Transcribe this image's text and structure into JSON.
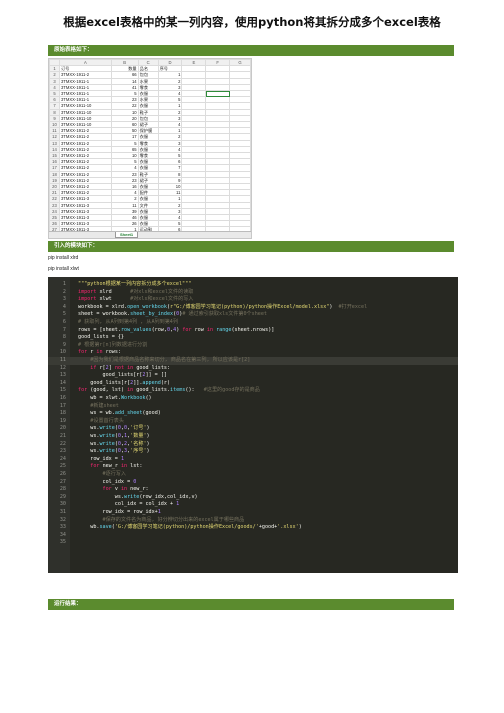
{
  "title": "根据excel表格中的某一列内容，使用python将其拆分成多个excel表格",
  "sections": {
    "original": "原始表格如下：",
    "imports": "引入的模块如下：",
    "result": "运行结果："
  },
  "pip_lines": [
    "pip install xlrd",
    "pip install xlwt"
  ],
  "excel": {
    "columns": [
      "",
      "A",
      "B",
      "C",
      "D",
      "E",
      "F",
      "G"
    ],
    "header_row": [
      "订号",
      "数量",
      "品名",
      "序号"
    ],
    "rows": [
      [
        "3TMXX-1911-2",
        "66",
        "包包",
        "1"
      ],
      [
        "3TMXX-1911-1",
        "14",
        "水果",
        "2"
      ],
      [
        "3TMXX-1911-1",
        "41",
        "零食",
        "3"
      ],
      [
        "3TMXX-1911-1",
        "5",
        "衣服",
        "4"
      ],
      [
        "3TMXX-1911-1",
        "23",
        "水果",
        "5"
      ],
      [
        "3TMXX-1911-10",
        "22",
        "衣服",
        "1"
      ],
      [
        "3TMXX-1911-10",
        "10",
        "鞋子",
        "2"
      ],
      [
        "3TMXX-1911-10",
        "20",
        "包包",
        "3"
      ],
      [
        "3TMXX-1911-10",
        "60",
        "裙子",
        "4"
      ],
      [
        "3TMXX-1911-2",
        "50",
        "保护膜",
        "1"
      ],
      [
        "3TMXX-1911-2",
        "17",
        "衣服",
        "2"
      ],
      [
        "3TMXX-1911-2",
        "5",
        "零食",
        "3"
      ],
      [
        "3TMXX-1911-2",
        "65",
        "衣服",
        "4"
      ],
      [
        "3TMXX-1911-2",
        "10",
        "零食",
        "5"
      ],
      [
        "3TMXX-1911-2",
        "5",
        "衣服",
        "6"
      ],
      [
        "3TMXX-1911-2",
        "4",
        "衣服",
        "7"
      ],
      [
        "3TMXX-1911-2",
        "23",
        "鞋子",
        "8"
      ],
      [
        "3TMXX-1911-2",
        "23",
        "裙子",
        "9"
      ],
      [
        "3TMXX-1911-2",
        "16",
        "衣服",
        "10"
      ],
      [
        "3TMXX-1911-2",
        "4",
        "配件",
        "11"
      ],
      [
        "3TMXX-1911-3",
        "2",
        "衣服",
        "1"
      ],
      [
        "3TMXX-1911-3",
        "11",
        "文件",
        "2"
      ],
      [
        "3TMXX-1911-3",
        "39",
        "衣服",
        "3"
      ],
      [
        "3TMXX-1911-3",
        "46",
        "衣服",
        "4"
      ],
      [
        "3TMXX-1911-3",
        "26",
        "衣服",
        "5"
      ],
      [
        "3TMXX-1911-3",
        "1",
        "运动鞋",
        "6"
      ]
    ],
    "sheet_tab": "Sheet1"
  },
  "code": {
    "highlight_line": 11,
    "lines": [
      [
        [
          "s",
          "\"\"\"python根据某一列内容拆分成多个excel\"\"\""
        ]
      ],
      [
        [
          "k",
          "import "
        ],
        [
          "",
          "xlrd      "
        ],
        [
          "c",
          "#对xls和excel文件的读取"
        ]
      ],
      [
        [
          "k",
          "import "
        ],
        [
          "",
          "xlwt      "
        ],
        [
          "c",
          "#对xls和excel文件的写入"
        ]
      ],
      [
        [
          "",
          "workbook = xlrd."
        ],
        [
          "f",
          "open_workbook"
        ],
        [
          "",
          "("
        ],
        [
          "s",
          "r\"G:/博客园学习笔记(python)/python操作Excel/model.xlsx\""
        ],
        [
          "",
          ")  "
        ],
        [
          "c",
          "#打开excel"
        ]
      ],
      [
        [
          "",
          "sheet = workbook."
        ],
        [
          "f",
          "sheet_by_index"
        ],
        [
          "",
          "("
        ],
        [
          "n",
          "0"
        ],
        [
          "",
          ")"
        ],
        [
          "c",
          "# 通过索引获取xls文件第0个sheet"
        ]
      ],
      [
        [
          "c",
          "# 获取列, 从A列到第4列 , 从A列到第4列"
        ]
      ],
      [
        [
          "",
          "rows = [sheet."
        ],
        [
          "f",
          "row_values"
        ],
        [
          "",
          "(row,"
        ],
        [
          "n",
          "0"
        ],
        [
          "",
          ","
        ],
        [
          "n",
          "4"
        ],
        [
          "",
          ") "
        ],
        [
          "k",
          "for "
        ],
        [
          "",
          "row "
        ],
        [
          "k",
          "in "
        ],
        [
          "f",
          "range"
        ],
        [
          "",
          "(sheet.nrows)]"
        ]
      ],
      [
        [
          "",
          "good_lists = {}"
        ]
      ],
      [
        [
          "c",
          "# 根据第r[n]列数据进行分割"
        ]
      ],
      [
        [
          "k",
          "for "
        ],
        [
          "",
          "r "
        ],
        [
          "k",
          "in "
        ],
        [
          "",
          "rows:"
        ]
      ],
      [
        [
          "",
          "    "
        ],
        [
          "c",
          "#因为我们是根据商品名称来切分, 商品名在第三列, 所以应该是r[2]"
        ]
      ],
      [
        [
          "",
          "    "
        ],
        [
          "k",
          "if "
        ],
        [
          "",
          "r["
        ],
        [
          "n",
          "2"
        ],
        [
          "",
          "] "
        ],
        [
          "k",
          "not in "
        ],
        [
          "",
          "good_lists:"
        ]
      ],
      [
        [
          "",
          "        good_lists[r["
        ],
        [
          "n",
          "2"
        ],
        [
          "",
          "]] = []"
        ]
      ],
      [
        [
          "",
          "    good_lists[r["
        ],
        [
          "n",
          "2"
        ],
        [
          "",
          "]]."
        ],
        [
          "f",
          "append"
        ],
        [
          "",
          "(r)"
        ]
      ],
      [
        [
          "k",
          "for "
        ],
        [
          "",
          "(good, lst) "
        ],
        [
          "k",
          "in "
        ],
        [
          "",
          "good_lists."
        ],
        [
          "f",
          "items"
        ],
        [
          "",
          "():   "
        ],
        [
          "c",
          "#这里的good存的是商品"
        ]
      ],
      [
        [
          "",
          "    wb = xlwt."
        ],
        [
          "f",
          "Workbook"
        ],
        [
          "",
          "()"
        ]
      ],
      [
        [
          "",
          "    "
        ],
        [
          "c",
          "#新建sheet"
        ]
      ],
      [
        [
          "",
          "    ws = wb."
        ],
        [
          "f",
          "add_sheet"
        ],
        [
          "",
          "(good)"
        ]
      ],
      [
        [
          "",
          "    "
        ],
        [
          "c",
          "#设置首行表头"
        ]
      ],
      [
        [
          "",
          "    ws."
        ],
        [
          "f",
          "write"
        ],
        [
          "",
          "("
        ],
        [
          "n",
          "0"
        ],
        [
          "",
          ","
        ],
        [
          "n",
          "0"
        ],
        [
          "",
          ","
        ],
        [
          "s",
          "'订号'"
        ],
        [
          "",
          ")"
        ]
      ],
      [
        [
          "",
          "    ws."
        ],
        [
          "f",
          "write"
        ],
        [
          "",
          "("
        ],
        [
          "n",
          "0"
        ],
        [
          "",
          ","
        ],
        [
          "n",
          "1"
        ],
        [
          "",
          ","
        ],
        [
          "s",
          "'数量'"
        ],
        [
          "",
          ")"
        ]
      ],
      [
        [
          "",
          "    ws."
        ],
        [
          "f",
          "write"
        ],
        [
          "",
          "("
        ],
        [
          "n",
          "0"
        ],
        [
          "",
          ","
        ],
        [
          "n",
          "2"
        ],
        [
          "",
          ","
        ],
        [
          "s",
          "'名称'"
        ],
        [
          "",
          ")"
        ]
      ],
      [
        [
          "",
          "    ws."
        ],
        [
          "f",
          "write"
        ],
        [
          "",
          "("
        ],
        [
          "n",
          "0"
        ],
        [
          "",
          ","
        ],
        [
          "n",
          "3"
        ],
        [
          "",
          ","
        ],
        [
          "s",
          "'序号'"
        ],
        [
          "",
          ")"
        ]
      ],
      [
        [
          "",
          "    row_idx = "
        ],
        [
          "n",
          "1"
        ]
      ],
      [
        [
          "",
          "    "
        ],
        [
          "k",
          "for "
        ],
        [
          "",
          "new_r "
        ],
        [
          "k",
          "in "
        ],
        [
          "",
          "lst:"
        ]
      ],
      [
        [
          "",
          "        "
        ],
        [
          "c",
          "#逐行写入"
        ]
      ],
      [
        [
          "",
          "        col_idx = "
        ],
        [
          "n",
          "0"
        ]
      ],
      [
        [
          "",
          "        "
        ],
        [
          "k",
          "for "
        ],
        [
          "",
          "v "
        ],
        [
          "k",
          "in "
        ],
        [
          "",
          "new_r:"
        ]
      ],
      [
        [
          "",
          "            ws."
        ],
        [
          "f",
          "write"
        ],
        [
          "",
          "(row_idx,col_idx,v)"
        ]
      ],
      [
        [
          "",
          "            col_idx = col_idx + "
        ],
        [
          "n",
          "1"
        ]
      ],
      [
        [
          "",
          "        row_idx = row_idx+"
        ],
        [
          "n",
          "1"
        ]
      ],
      [
        [
          "",
          "        "
        ],
        [
          "c",
          "#保存的文件名为商品, 好分辨切分出来的excel属于哪些商品"
        ]
      ],
      [
        [
          "",
          "    wb."
        ],
        [
          "f",
          "save"
        ],
        [
          "",
          "("
        ],
        [
          "s",
          "'G:/博客园学习笔记(python)/python操作Excel/goods/'"
        ],
        [
          "",
          "+good+"
        ],
        [
          "s",
          "'.xlsx'"
        ],
        [
          "",
          ")"
        ]
      ],
      [],
      []
    ]
  }
}
